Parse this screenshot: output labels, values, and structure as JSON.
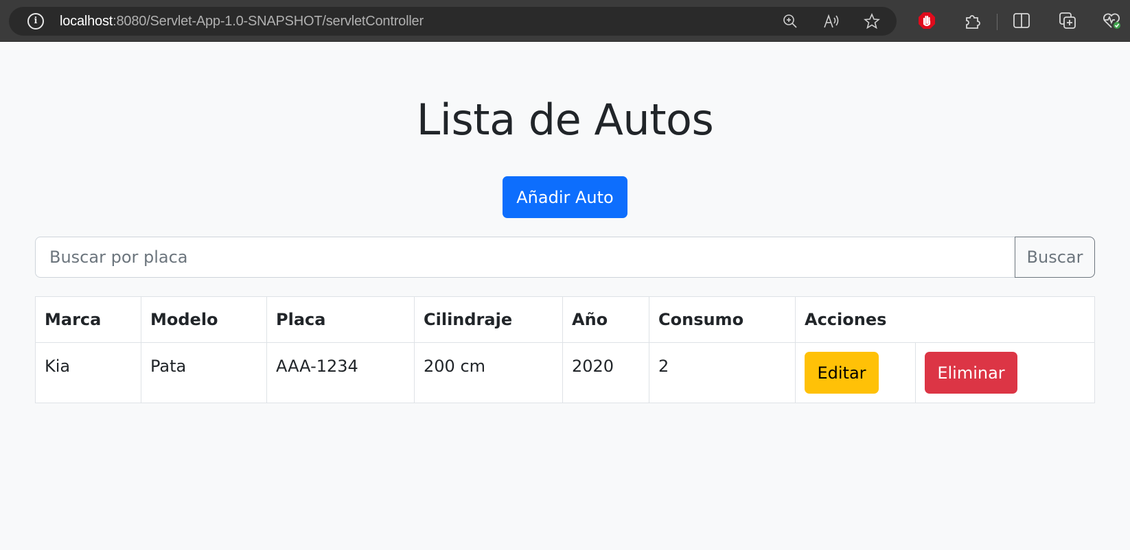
{
  "browser": {
    "url_host": "localhost",
    "url_path": ":8080/Servlet-App-1.0-SNAPSHOT/servletController",
    "info_icon_glyph": "i",
    "icons": [
      "info-icon",
      "zoom-icon",
      "read-aloud-icon",
      "favorite-star-icon",
      "adblock-hand-icon",
      "extensions-icon",
      "split-screen-icon",
      "collections-icon",
      "browser-health-icon"
    ]
  },
  "page": {
    "title": "Lista de Autos",
    "add_button_label": "Añadir Auto",
    "search": {
      "placeholder": "Buscar por placa",
      "value": "",
      "button_label": "Buscar"
    },
    "table": {
      "headers": [
        "Marca",
        "Modelo",
        "Placa",
        "Cilindraje",
        "Año",
        "Consumo",
        "Acciones"
      ],
      "rows": [
        {
          "marca": "Kia",
          "modelo": "Pata",
          "placa": "AAA-1234",
          "cilindraje": "200 cm",
          "anio": "2020",
          "consumo": "2",
          "edit_label": "Editar",
          "delete_label": "Eliminar"
        }
      ]
    }
  },
  "colors": {
    "primary": "#0d6efd",
    "warning": "#ffc107",
    "danger": "#dc3545",
    "page_bg": "#f8f9fa",
    "browser_bar": "#3b3b3b"
  }
}
